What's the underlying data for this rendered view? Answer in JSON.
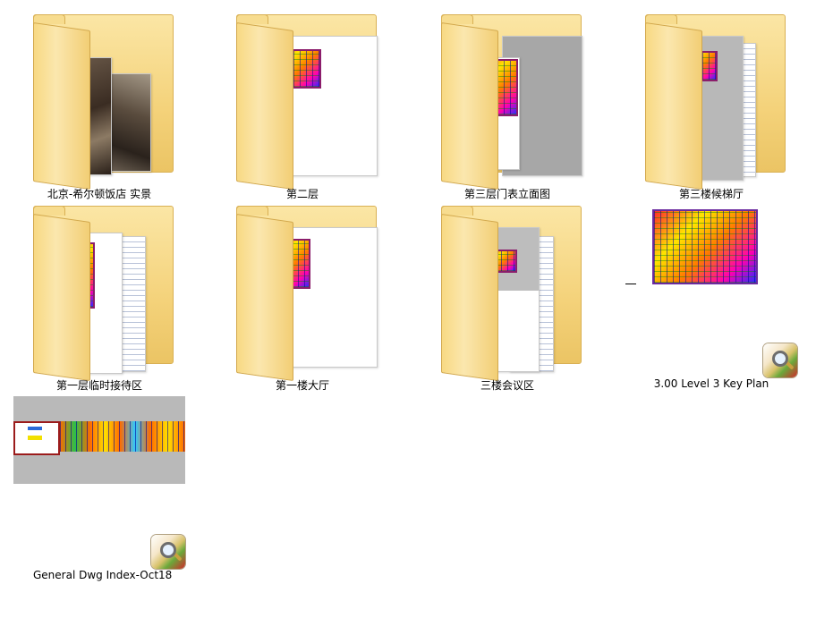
{
  "items": [
    {
      "name": "北京-希尔顿饭店 实景",
      "type": "folder",
      "preview": "photos"
    },
    {
      "name": "第二层",
      "type": "folder",
      "preview": "cad"
    },
    {
      "name": "第三层门表立面图",
      "type": "folder",
      "preview": "cad"
    },
    {
      "name": "第三楼候梯厅",
      "type": "folder",
      "preview": "cad-lines"
    },
    {
      "name": "第一层临时接待区",
      "type": "folder",
      "preview": "cad-lines"
    },
    {
      "name": "第一楼大厅",
      "type": "folder",
      "preview": "cad"
    },
    {
      "name": "三楼会议区",
      "type": "folder",
      "preview": "cad-lines"
    },
    {
      "name": "3.00 Level 3 Key Plan",
      "type": "dwg",
      "preview": "cad-plan"
    },
    {
      "name": "General Dwg Index-Oct18",
      "type": "dwg",
      "preview": "cad-strip"
    }
  ],
  "icons": {
    "folder": "folder-icon",
    "dwg": "dwg-file-icon"
  }
}
